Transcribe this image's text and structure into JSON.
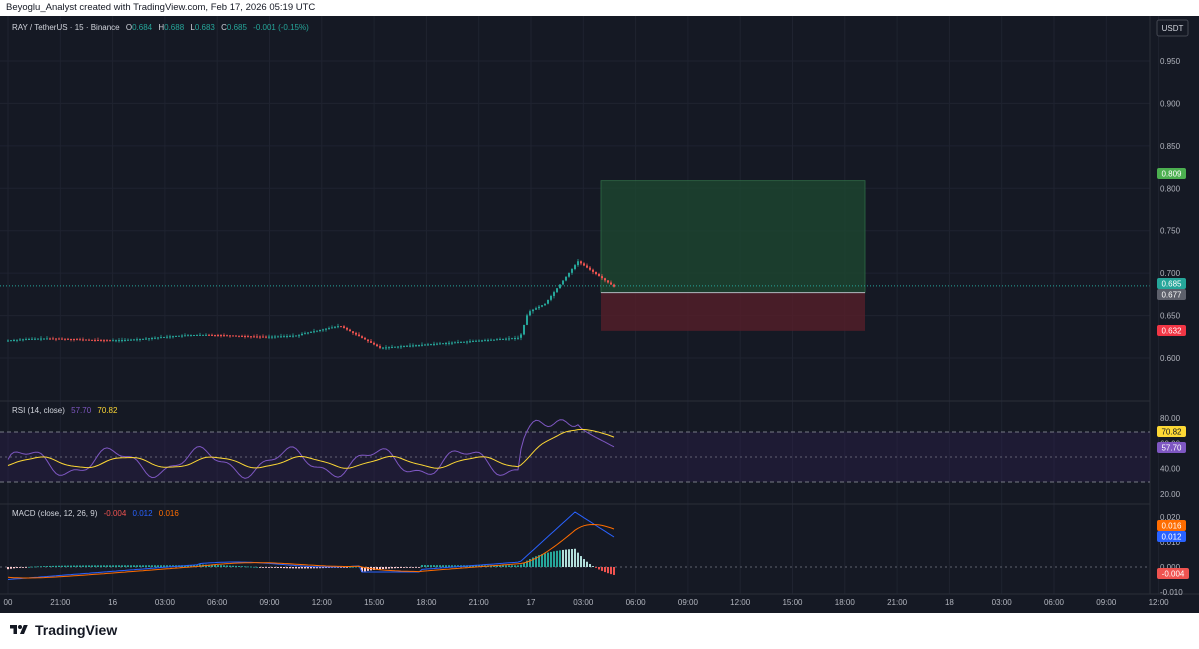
{
  "header": {
    "attribution": "Beyoglu_Analyst created with TradingView.com, Feb 17, 2026 05:19 UTC"
  },
  "legend": {
    "symbol": "RAY / TetherUS · 15 · Binance",
    "open_label": "O",
    "open": "0.684",
    "high_label": "H",
    "high": "0.688",
    "low_label": "L",
    "low": "0.683",
    "close_label": "C",
    "close": "0.685",
    "change": "-0.001 (-0.15%)"
  },
  "currency_button": "USDT",
  "price_axis": {
    "ticks": [
      "0.950",
      "0.900",
      "0.850",
      "0.800",
      "0.750",
      "0.700",
      "0.650",
      "0.600"
    ]
  },
  "price_labels": {
    "target": "0.809",
    "last": "0.685",
    "entry": "0.677",
    "stop": "0.632"
  },
  "position_tool": {
    "entry": 0.677,
    "target": 0.809,
    "stop": 0.632
  },
  "rsi": {
    "title": "RSI (14, close)",
    "value": "57.70",
    "ma_value": "70.82",
    "axis_ticks": [
      "80.00",
      "60.00",
      "40.00",
      "20.00"
    ],
    "label_ma": "70.82",
    "label_rsi": "57.70"
  },
  "macd": {
    "title": "MACD (close, 12, 26, 9)",
    "hist": "-0.004",
    "macd": "0.012",
    "signal": "0.016",
    "axis_ticks": [
      "0.020",
      "0.010",
      "0.000",
      "-0.010"
    ],
    "label_signal": "0.016",
    "label_macd": "0.012",
    "label_hist": "-0.004"
  },
  "time_axis": [
    "00",
    "21:00",
    "16",
    "03:00",
    "06:00",
    "09:00",
    "12:00",
    "15:00",
    "18:00",
    "21:00",
    "17",
    "03:00",
    "06:00",
    "09:00",
    "12:00",
    "15:00",
    "18:00",
    "21:00",
    "18",
    "03:00",
    "06:00",
    "09:00",
    "12:00"
  ],
  "footer": {
    "brand": "TradingView"
  },
  "colors": {
    "up": "#26a69a",
    "down": "#ef5350",
    "bg": "#151924",
    "rsi": "#7e57c2",
    "rsi_ma": "#fdd835",
    "macd": "#2962ff",
    "signal": "#ff6d00"
  }
}
